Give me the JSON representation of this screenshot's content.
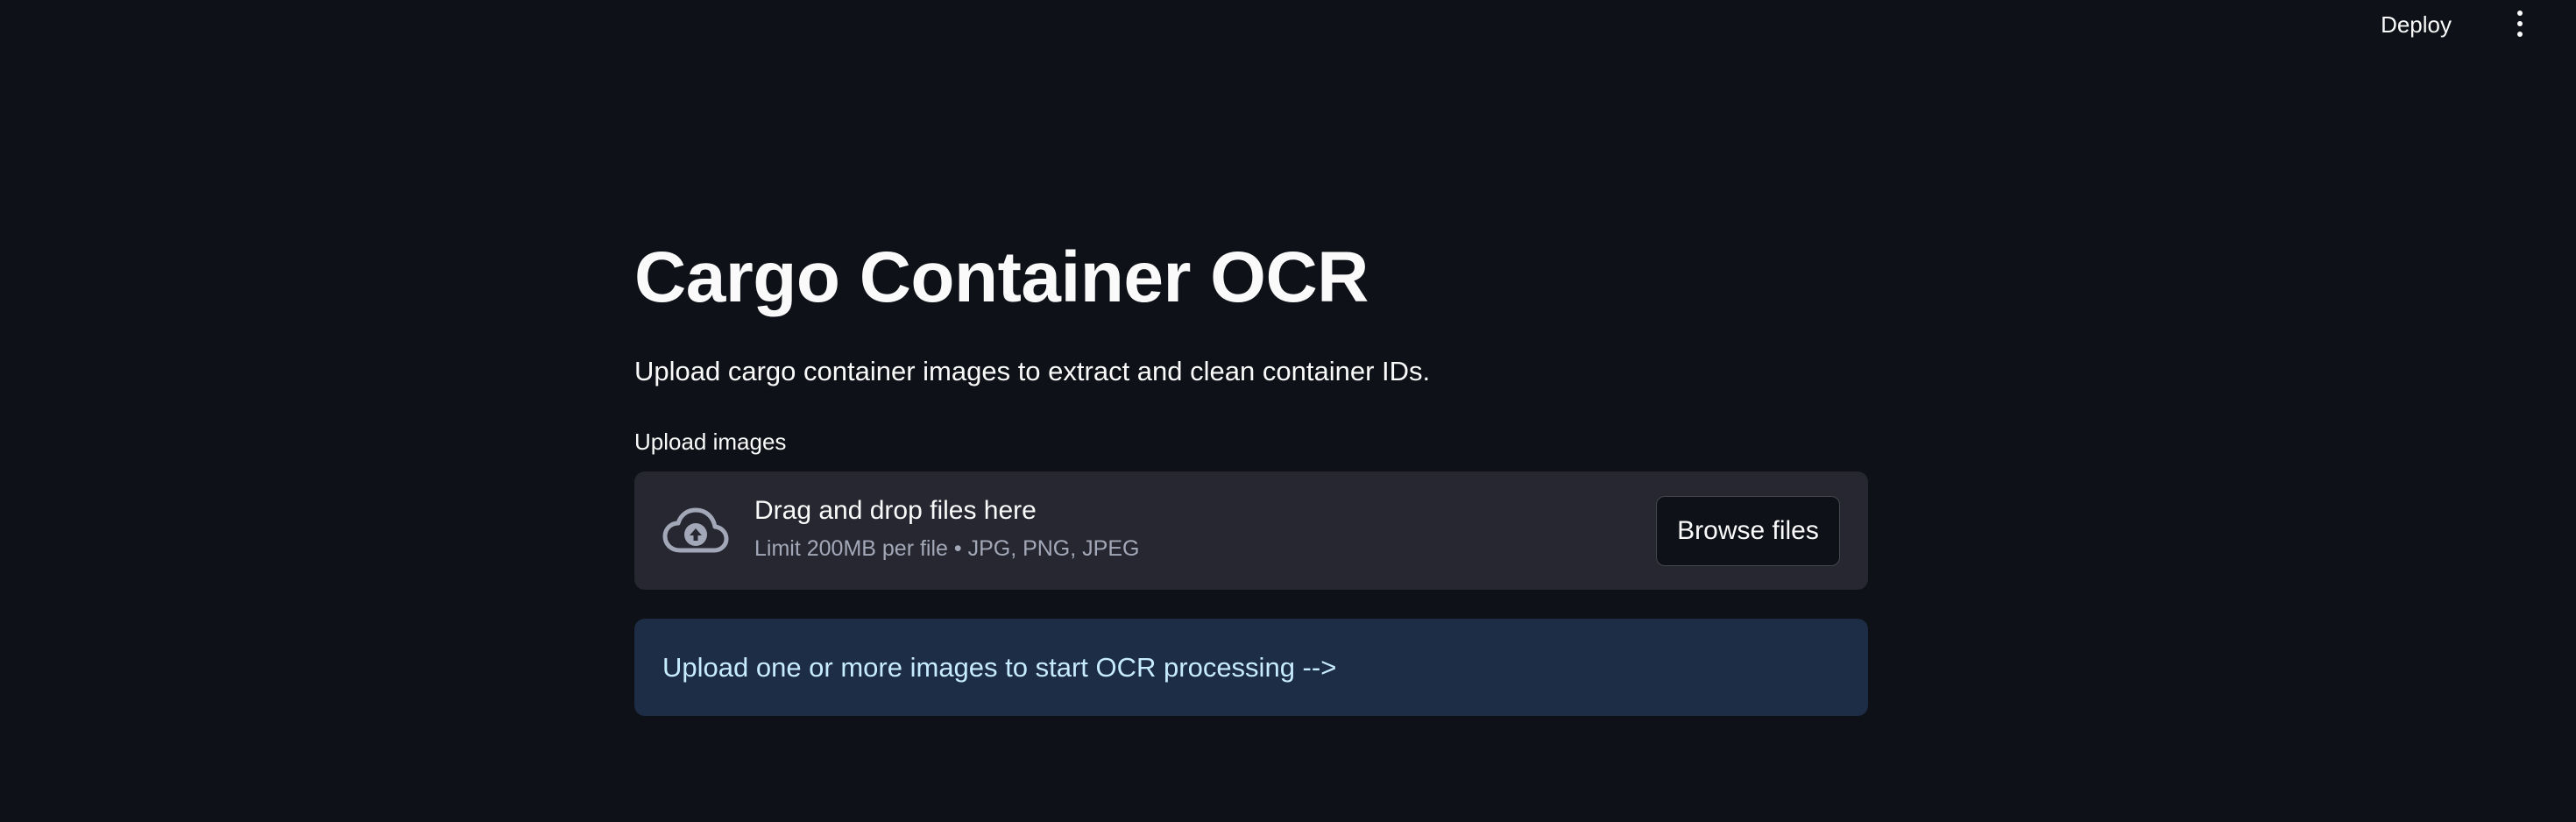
{
  "header": {
    "deploy_label": "Deploy",
    "menu_icon": "kebab-menu-icon"
  },
  "main": {
    "title": "Cargo Container OCR",
    "subtitle": "Upload cargo container images to extract and clean container IDs."
  },
  "uploader": {
    "label": "Upload images",
    "icon": "cloud-upload-icon",
    "drop_text": "Drag and drop files here",
    "limit_text": "Limit 200MB per file • JPG, PNG, JPEG",
    "browse_label": "Browse files"
  },
  "info": {
    "message": "Upload one or more images to start OCR processing -->"
  },
  "colors": {
    "background": "#0e1117",
    "dropzone": "#262730",
    "info_background": "#1c2d45",
    "info_text": "#c7ebff",
    "muted_text": "#a3a8b8"
  }
}
